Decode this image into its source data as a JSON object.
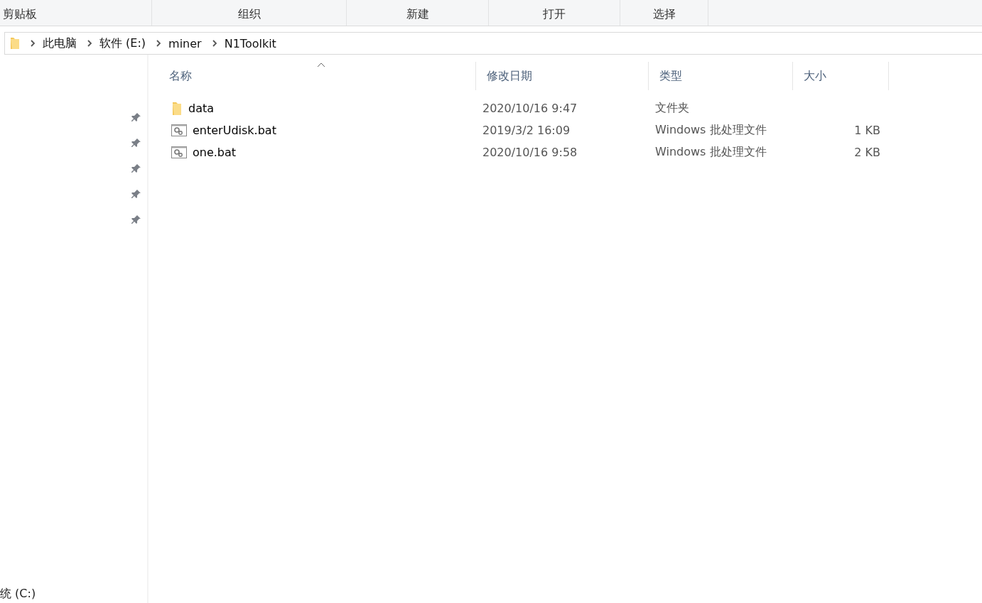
{
  "ribbon": {
    "groups": [
      "剪贴板",
      "组织",
      "新建",
      "打开",
      "选择"
    ]
  },
  "address_bar": {
    "path": [
      "此电脑",
      "软件 (E:)",
      "miner",
      "N1Toolkit"
    ]
  },
  "sidebar": {
    "bottom_item": "统 (C:)"
  },
  "file_list": {
    "columns": [
      {
        "label": "名称",
        "sorted": true
      },
      {
        "label": "修改日期",
        "sorted": false
      },
      {
        "label": "类型",
        "sorted": false
      },
      {
        "label": "大小",
        "sorted": false
      }
    ],
    "rows": [
      {
        "kind": "folder",
        "name": "data",
        "modified": "2020/10/16 9:47",
        "type": "文件夹",
        "size": ""
      },
      {
        "kind": "batch",
        "name": "enterUdisk.bat",
        "modified": "2019/3/2 16:09",
        "type": "Windows 批处理文件",
        "size": "1 KB"
      },
      {
        "kind": "batch",
        "name": "one.bat",
        "modified": "2020/10/16 9:58",
        "type": "Windows 批处理文件",
        "size": "2 KB"
      }
    ]
  }
}
